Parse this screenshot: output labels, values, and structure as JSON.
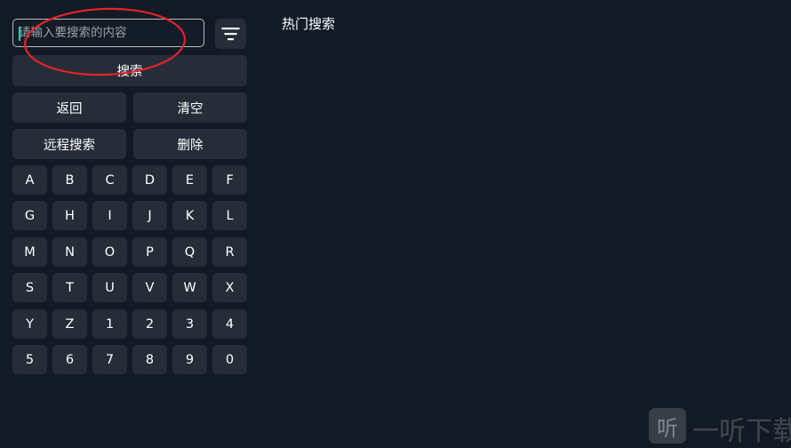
{
  "search": {
    "value": "",
    "placeholder": "请输入要搜索的内容"
  },
  "filter": {
    "icon": "filter-icon"
  },
  "actions": {
    "search_label": "搜索",
    "back_label": "返回",
    "clear_label": "清空",
    "remote_search_label": "远程搜索",
    "delete_label": "删除"
  },
  "keyboard": {
    "keys": [
      "A",
      "B",
      "C",
      "D",
      "E",
      "F",
      "G",
      "H",
      "I",
      "J",
      "K",
      "L",
      "M",
      "N",
      "O",
      "P",
      "Q",
      "R",
      "S",
      "T",
      "U",
      "V",
      "W",
      "X",
      "Y",
      "Z",
      "1",
      "2",
      "3",
      "4",
      "5",
      "6",
      "7",
      "8",
      "9",
      "0"
    ]
  },
  "hot_search": {
    "title": "热门搜索"
  },
  "watermark": {
    "icon_char": "听",
    "text": "一听下载"
  },
  "colors": {
    "background": "#121a26",
    "button": "#262d39",
    "cursor": "#2bd5a9",
    "annotation": "#e3232a"
  }
}
